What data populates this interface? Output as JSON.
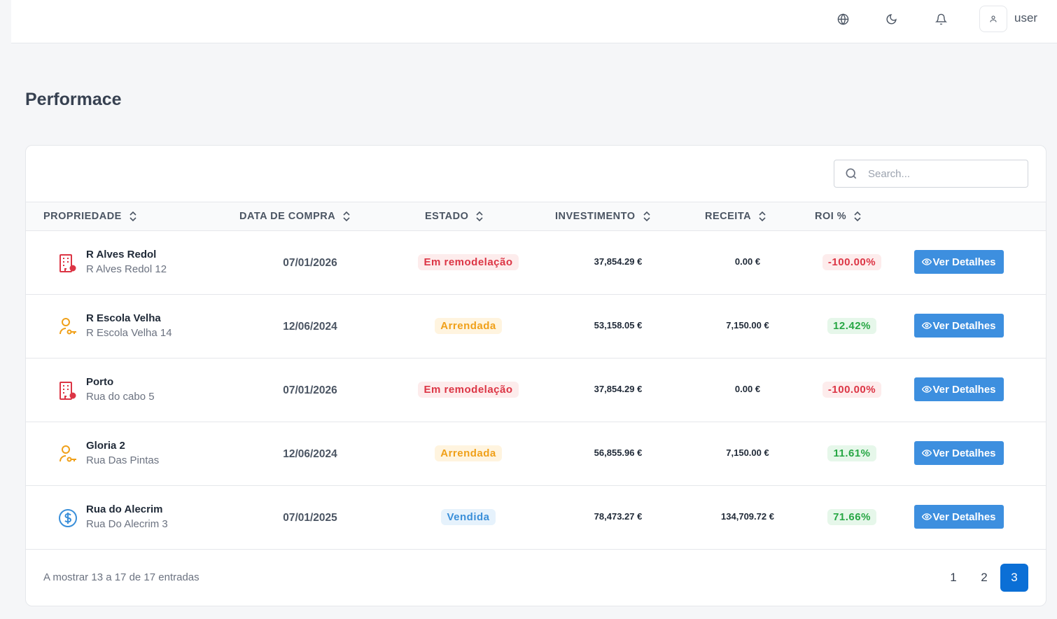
{
  "header": {
    "icons": [
      "globe-icon",
      "moon-icon",
      "bell-icon",
      "user-icon"
    ],
    "username": "user"
  },
  "page": {
    "title": "Performace"
  },
  "search": {
    "placeholder": "Search...",
    "value": ""
  },
  "table": {
    "columns": [
      "PROPRIEDADE",
      "DATA DE COMPRA",
      "ESTADO",
      "INVESTIMENTO",
      "RECEITA",
      "ROI %"
    ],
    "rows": [
      {
        "icon": "building-gear-icon",
        "name": "R Alves Redol",
        "address": "R Alves Redol 12",
        "date": "07/01/2026",
        "status": "Em remodelação",
        "investment": "37,854.29 €",
        "revenue": "0.00 €",
        "roi": "-100.00%",
        "action": "Ver Detalhes"
      },
      {
        "icon": "user-key-icon",
        "name": "R Escola Velha",
        "address": "R Escola Velha 14",
        "date": "12/06/2024",
        "status": "Arrendada",
        "investment": "53,158.05 €",
        "revenue": "7,150.00 €",
        "roi": "12.42%",
        "action": "Ver Detalhes"
      },
      {
        "icon": "building-gear-icon",
        "name": "Porto",
        "address": "Rua do cabo 5",
        "date": "07/01/2026",
        "status": "Em remodelação",
        "investment": "37,854.29 €",
        "revenue": "0.00 €",
        "roi": "-100.00%",
        "action": "Ver Detalhes"
      },
      {
        "icon": "user-key-icon",
        "name": "Gloria 2",
        "address": "Rua Das Pintas",
        "date": "12/06/2024",
        "status": "Arrendada",
        "investment": "56,855.96 €",
        "revenue": "7,150.00 €",
        "roi": "11.61%",
        "action": "Ver Detalhes"
      },
      {
        "icon": "dollar-circle-icon",
        "name": "Rua do Alecrim",
        "address": "Rua Do Alecrim 3",
        "date": "07/01/2025",
        "status": "Vendida",
        "investment": "78,473.27 €",
        "revenue": "134,709.72 €",
        "roi": "71.66%",
        "action": "Ver Detalhes"
      }
    ]
  },
  "footer": {
    "summary": "A mostrar 13 a 17 de 17 entradas",
    "pages": [
      "1",
      "2",
      "3"
    ],
    "current_page": "3"
  },
  "colors": {
    "primary": "#3d8fdf",
    "active_page": "#0b6fd6",
    "danger": "#dc3545",
    "warning": "#f0a019",
    "success": "#28a745",
    "info": "#3a8fd9"
  }
}
